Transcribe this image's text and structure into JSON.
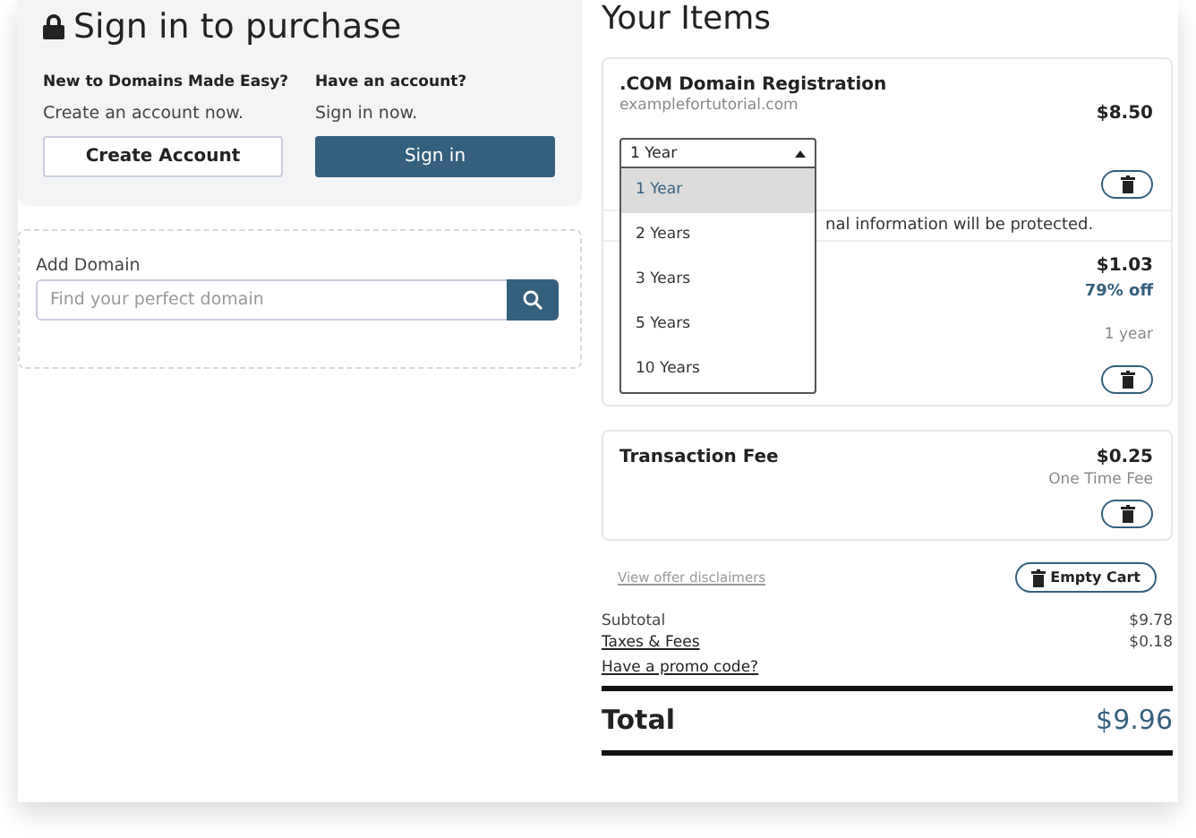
{
  "signin": {
    "title": "Sign in to purchase",
    "new_heading": "New to Domains Made Easy?",
    "new_text": "Create an account now.",
    "create_button": "Create Account",
    "existing_heading": "Have an account?",
    "existing_text": "Sign in now.",
    "signin_button": "Sign in"
  },
  "add_domain": {
    "label": "Add Domain",
    "placeholder": "Find your perfect domain"
  },
  "items_title": "Your Items",
  "domain_item": {
    "name": ".COM Domain Registration",
    "domain": "examplefortutorial.com",
    "price": "$8.50",
    "term_select": {
      "value": "1 Year",
      "open": true,
      "options": [
        {
          "label": "1 Year",
          "selected": true
        },
        {
          "label": "2 Years",
          "selected": false
        },
        {
          "label": "3 Years",
          "selected": false
        },
        {
          "label": "5 Years",
          "selected": false
        },
        {
          "label": "10 Years",
          "selected": false
        }
      ]
    },
    "notice": "nal information will be protected.",
    "addon": {
      "price": "$1.03",
      "discount": "79% off",
      "term": "1 year"
    }
  },
  "fee_item": {
    "name": "Transaction Fee",
    "price": "$0.25",
    "note": "One Time Fee"
  },
  "disclaimers_link": "View offer disclaimers",
  "empty_cart_button": "Empty Cart",
  "summary": [
    {
      "label": "Subtotal",
      "value": "$9.78",
      "link": false
    },
    {
      "label": "Taxes & Fees",
      "value": "$0.18",
      "link": true
    }
  ],
  "promo_link": "Have a promo code?",
  "total": {
    "label": "Total",
    "value": "$9.96"
  }
}
